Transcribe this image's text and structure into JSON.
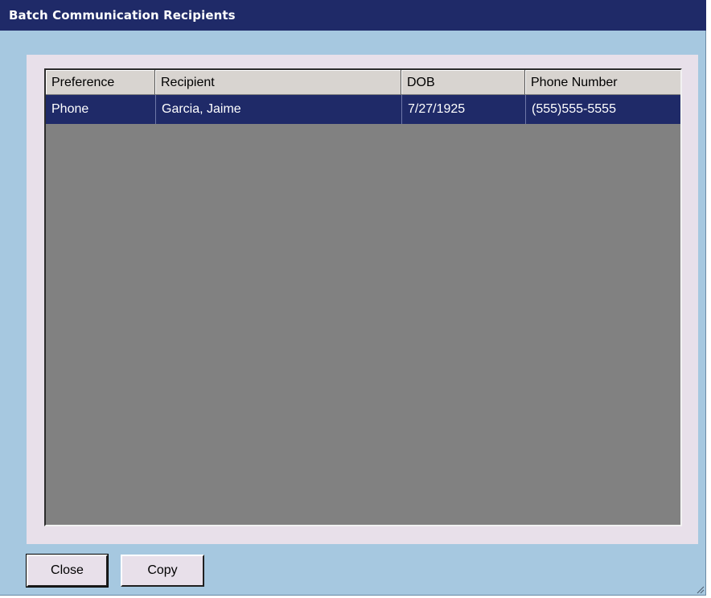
{
  "window": {
    "title": "Batch Communication Recipients"
  },
  "table": {
    "columns": [
      "Preference",
      "Recipient",
      "DOB",
      "Phone Number"
    ],
    "rows": [
      {
        "preference": "Phone",
        "recipient": "Garcia, Jaime",
        "dob": "7/27/1925",
        "phone": "(555)555-5555",
        "selected": true
      }
    ]
  },
  "buttons": {
    "close_label": "Close",
    "copy_label": "Copy"
  },
  "colors": {
    "title_bar": "#1f2a68",
    "window_bg": "#a6c8e0",
    "panel_bg": "#e8e0ea",
    "list_bg": "#818181",
    "selection": "#1f2a68"
  },
  "icons": {
    "resize_grip": "resize-grip-icon"
  }
}
